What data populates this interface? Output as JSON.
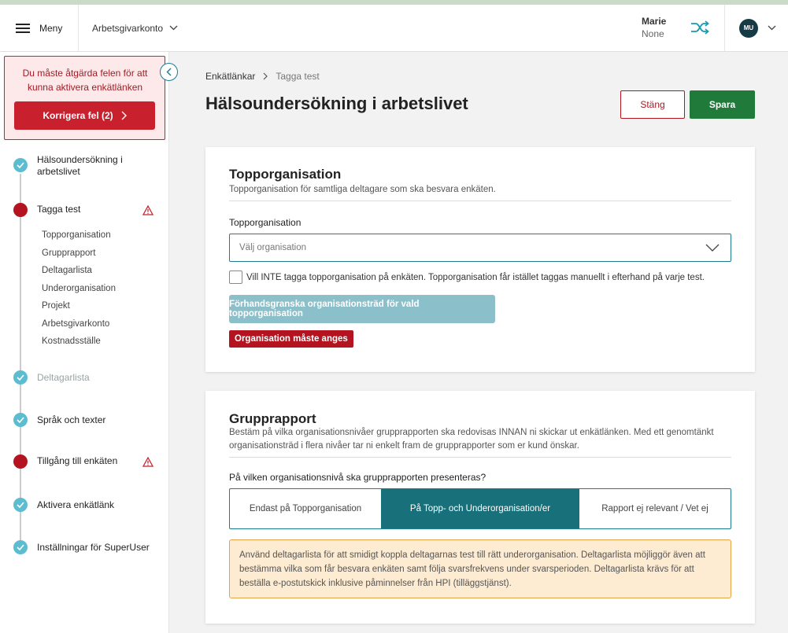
{
  "topbar": {
    "menu_label": "Meny",
    "account_label": "Arbetsgivarkonto",
    "user_name": "Marie",
    "user_org": "None",
    "avatar_initials": "MU"
  },
  "sidebar": {
    "error_text": "Du måste åtgärda felen för att kunna aktivera enkätlänken",
    "fix_button": "Korrigera fel (2)",
    "steps": [
      {
        "label": "Hälsoundersökning i arbetslivet",
        "status": "done"
      },
      {
        "label": "Tagga test",
        "status": "error"
      },
      {
        "label": "Deltagarlista",
        "status": "done-disabled"
      },
      {
        "label": "Språk och texter",
        "status": "done"
      },
      {
        "label": "Tillgång till enkäten",
        "status": "error"
      },
      {
        "label": "Aktivera enkätlänk",
        "status": "done"
      },
      {
        "label": "Inställningar för SuperUser",
        "status": "done"
      }
    ],
    "substeps": [
      "Topporganisation",
      "Grupprapport",
      "Deltagarlista",
      "Underorganisation",
      "Projekt",
      "Arbetsgivarkonto",
      "Kostnadsställe"
    ]
  },
  "breadcrumb": {
    "parent": "Enkätlänkar",
    "current": "Tagga test"
  },
  "page": {
    "title": "Hälsoundersökning i arbetslivet",
    "close_button": "Stäng",
    "save_button": "Spara"
  },
  "topp": {
    "title": "Topporganisation",
    "description": "Topporganisation för samtliga deltagare som ska besvara enkäten.",
    "field_label": "Topporganisation",
    "select_placeholder": "Välj organisation",
    "checkbox_label": "Vill INTE tagga topporganisation på enkäten. Topporganisation får istället taggas manuellt i efterhand på varje test.",
    "preview_button": "Förhandsgranska organisationsträd för vald topporganisation",
    "error_message": "Organisation måste anges"
  },
  "grupp": {
    "title": "Grupprapport",
    "description": "Bestäm på vilka organisationsnivåer grupprapporten ska redovisas INNAN ni skickar ut enkätlänken. Med ett genomtänkt organisationsträd i flera nivåer tar ni enkelt fram de grupprapporter som er kund önskar.",
    "question": "På vilken organisationsnivå ska grupprapporten presenteras?",
    "options": [
      "Endast på Topporganisation",
      "På Topp- och Underorganisation/er",
      "Rapport ej relevant / Vet ej"
    ],
    "selected_index": 1,
    "info_text": "Använd deltagarlista för att smidigt koppla deltagarnas test till rätt underorganisation. Deltagarlista möjliggör även att bestämma vilka som får besvara enkäten samt följa svarsfrekvens under svarsperioden. Deltagarlista krävs för att beställa e-postutskick inklusive påminnelser från HPI (tilläggstjänst)."
  },
  "colors": {
    "primary_teal": "#17707a",
    "error_red": "#b3141f",
    "save_green": "#207a3a",
    "step_done": "#5bbdcf",
    "info_bg": "#fdebd2"
  }
}
